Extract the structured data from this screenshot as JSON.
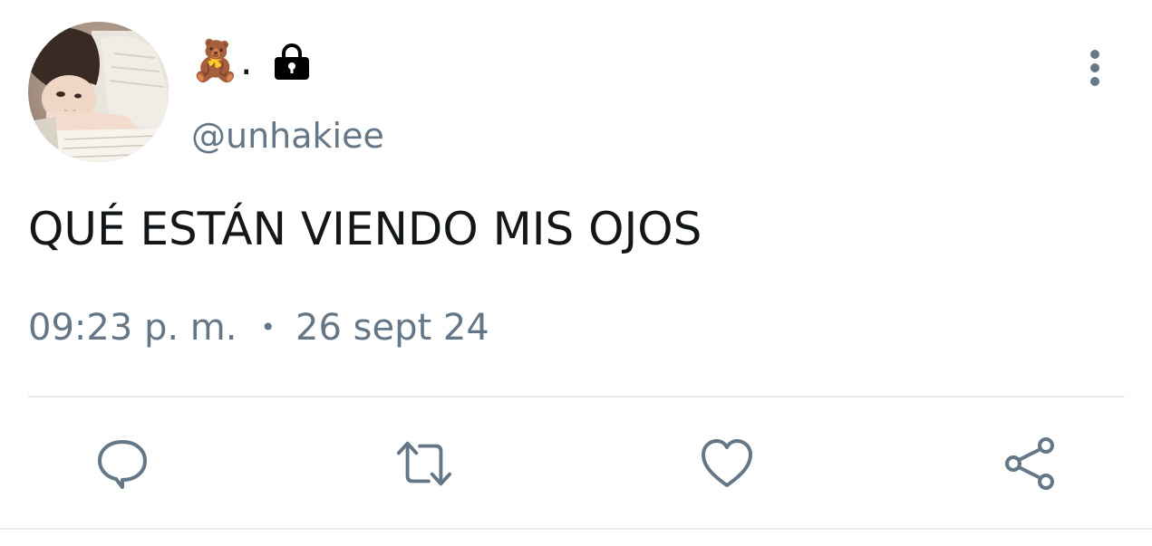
{
  "tweet": {
    "display_name": "🧸.",
    "protected_icon": "lock-icon",
    "handle": "@unhakiee",
    "text": "QUÉ ESTÁN VIENDO MIS OJOS",
    "time": "09:23 p. m.",
    "separator": "•",
    "date": "26 sept 24"
  },
  "actions": {
    "reply": "reply-icon",
    "retweet": "retweet-icon",
    "like": "heart-icon",
    "share": "share-icon"
  },
  "colors": {
    "text": "#14171a",
    "secondary": "#657786",
    "divider": "#e6ecf0"
  }
}
